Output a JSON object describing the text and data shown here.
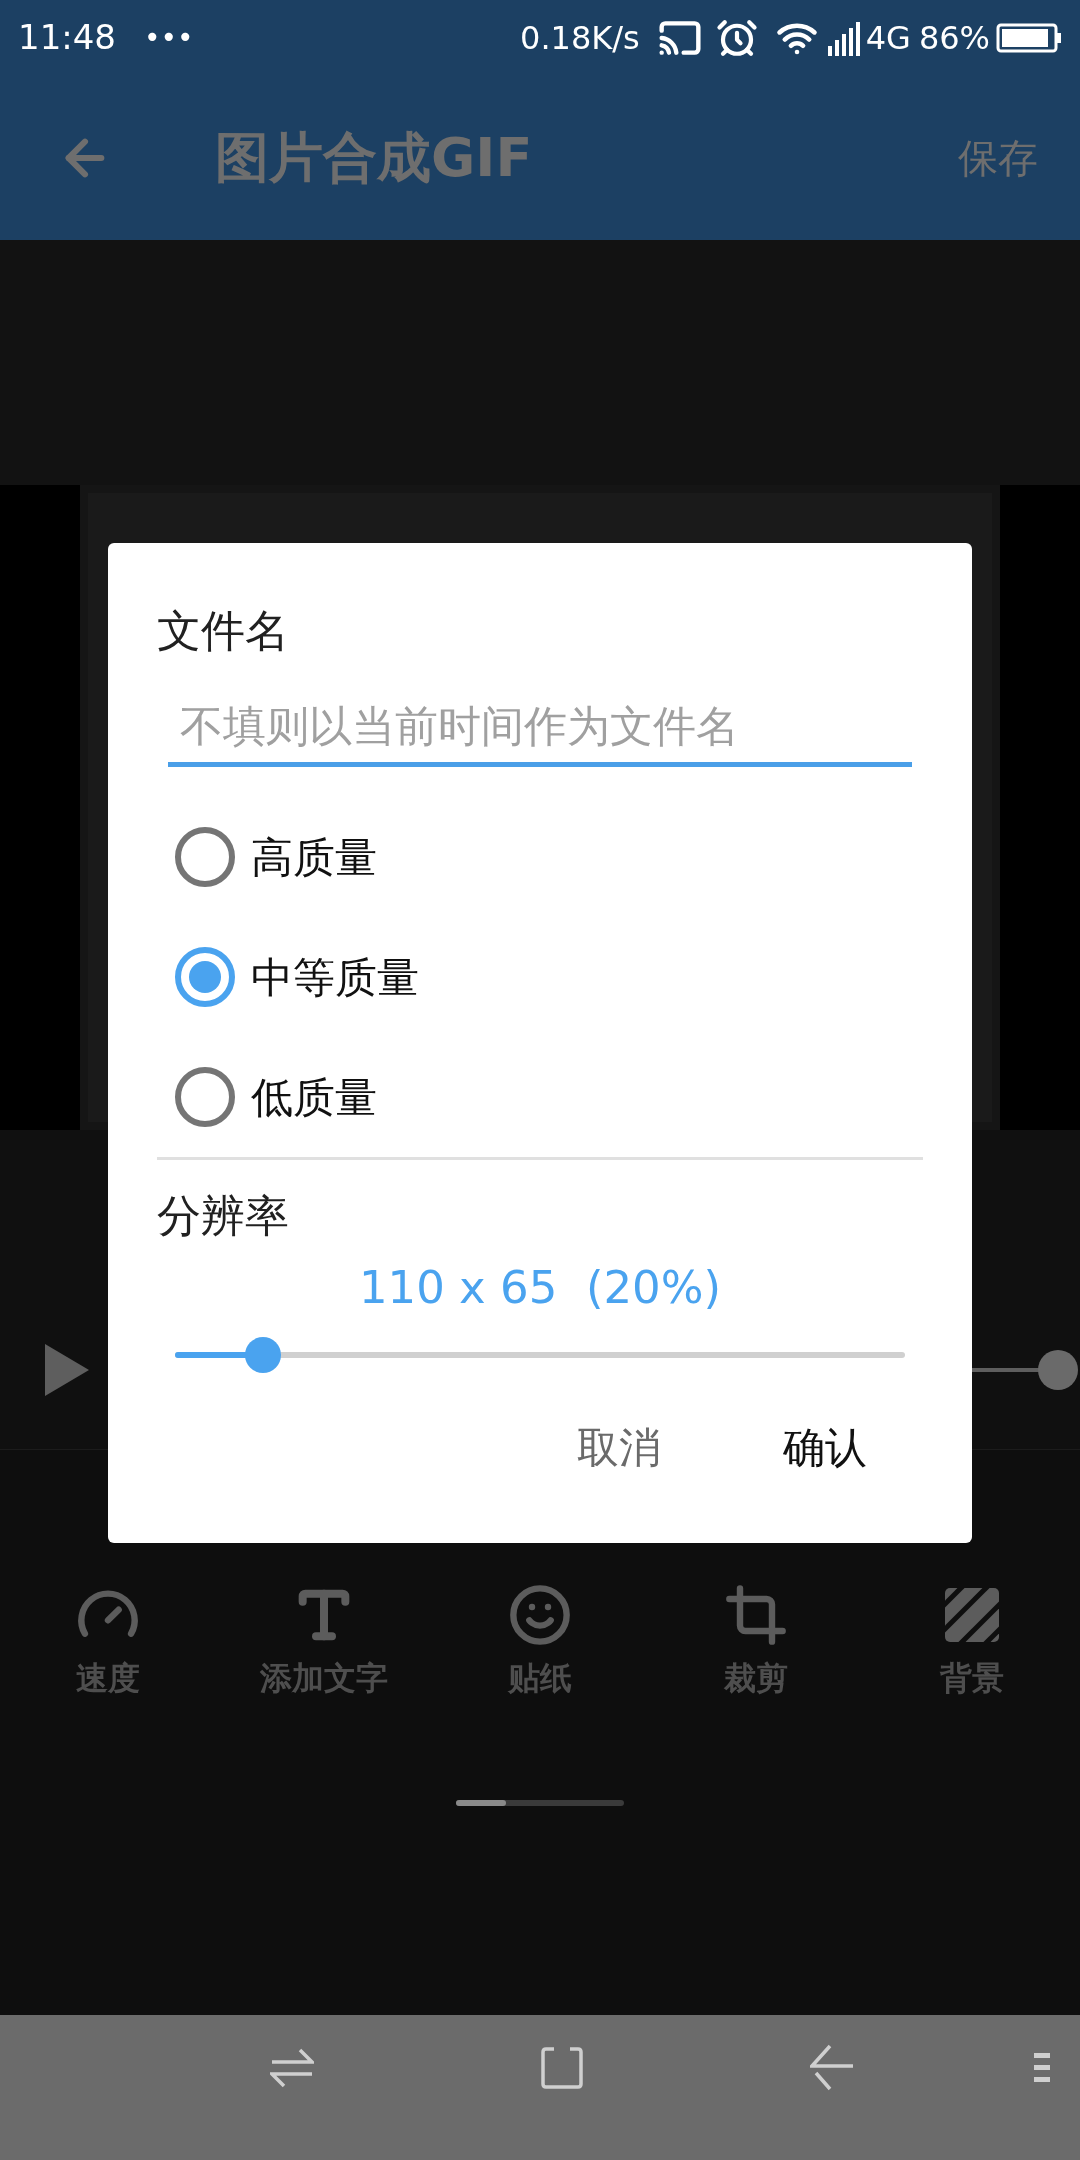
{
  "status_bar": {
    "time": "11:48",
    "indicator": "•••",
    "speed": "0.18K/s",
    "network": "4G",
    "battery": "86%"
  },
  "app_bar": {
    "title": "图片合成GIF",
    "action": "保存"
  },
  "timeline": {
    "level": 1
  },
  "tools": [
    {
      "label": "速度",
      "kind": "speed"
    },
    {
      "label": "添加文字",
      "kind": "text"
    },
    {
      "label": "贴纸",
      "kind": "sticker"
    },
    {
      "label": "裁剪",
      "kind": "crop"
    },
    {
      "label": "背景",
      "kind": "background"
    }
  ],
  "dialog": {
    "title": "文件名",
    "filename_field": {
      "placeholder": "不填则以当前时间作为文件名"
    },
    "quality_options": [
      {
        "label": "高质量",
        "selected": false
      },
      {
        "label": "中等质量",
        "selected": true
      },
      {
        "label": "低质量",
        "selected": false
      }
    ],
    "resolution": {
      "label": "分辨率",
      "reading": "110 x 65  (20%)",
      "level": 0.12
    },
    "buttons": [
      {
        "label": "取消",
        "kind": "cancel"
      },
      {
        "label": "确认",
        "kind": "confirm"
      }
    ]
  }
}
